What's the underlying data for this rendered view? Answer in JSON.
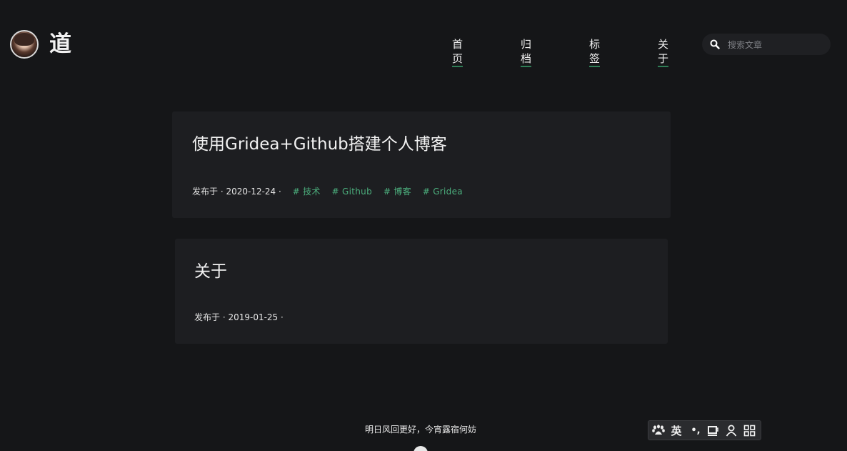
{
  "site": {
    "title": "道"
  },
  "nav": {
    "items": [
      {
        "label": "首页"
      },
      {
        "label": "归档"
      },
      {
        "label": "标签"
      },
      {
        "label": "关于"
      }
    ]
  },
  "search": {
    "placeholder": "搜索文章",
    "value": ""
  },
  "posts": [
    {
      "title": "使用Gridea+Github搭建个人博客",
      "meta_prefix": "发布于 · 2020-12-24 ·",
      "tags": [
        "# 技术",
        "# Github",
        "# 博客",
        "# Gridea"
      ]
    },
    {
      "title": "关于",
      "meta_prefix": "发布于 · 2019-01-25 ·",
      "tags": []
    }
  ],
  "footer": {
    "text": "明日风回更好，今宵露宿何妨"
  },
  "ime": {
    "lang": "英",
    "punct": "•,"
  },
  "colors": {
    "background": "#151618",
    "card": "#1d1e21",
    "accent": "#4caf7d",
    "nav_underline": "#2e7d55"
  }
}
